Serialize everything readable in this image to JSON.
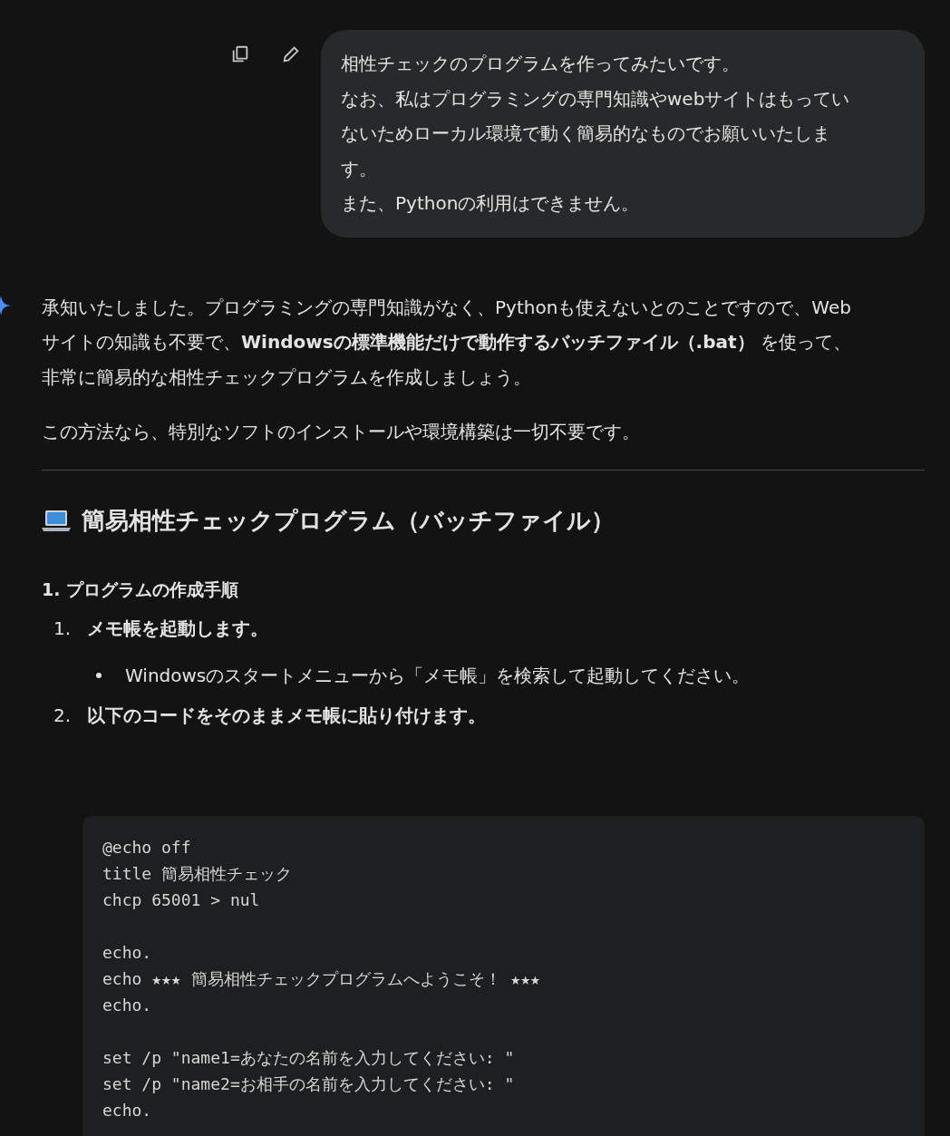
{
  "user_message": {
    "lines": [
      "相性チェックのプログラムを作ってみたいです。",
      "なお、私はプログラミングの専門知識やwebサイトはもってい",
      "ないためローカル環境で動く簡易的なものでお願いいたしま",
      "す。",
      "また、Pythonの利用はできません。"
    ]
  },
  "response": {
    "intro_lines": [
      "承知いたしました。プログラミングの専門知識がなく、Pythonも使えないとのことですので、Web",
      "サイトの知識も不要で、**Windowsの標準機能だけで動作するバッチファイル（.bat）** を使って、",
      "非常に簡易的な相性チェックプログラムを作成しましょう。"
    ],
    "note": "この方法なら、特別なソフトのインストールや環境構築は一切不要です。",
    "heading": "簡易相性チェックプログラム（バッチファイル）",
    "subheading": "1. プログラムの作成手順",
    "steps": [
      {
        "number": "1.",
        "text": "メモ帳を起動します。",
        "bullets": [
          "Windowsのスタートメニューから「メモ帳」を検索して起動してください。"
        ]
      },
      {
        "number": "2.",
        "text": "以下のコードをそのままメモ帳に貼り付けます。"
      }
    ],
    "code_blocks": [
      [
        "@echo off",
        "title 簡易相性チェック",
        "chcp 65001 > nul"
      ],
      [
        "echo.",
        "echo ★★★ 簡易相性チェックプログラムへようこそ！ ★★★",
        "echo."
      ],
      [
        "set /p \"name1=あなたの名前を入力してください: \"",
        "set /p \"name2=お相手の名前を入力してください: \"",
        "echo."
      ]
    ]
  }
}
